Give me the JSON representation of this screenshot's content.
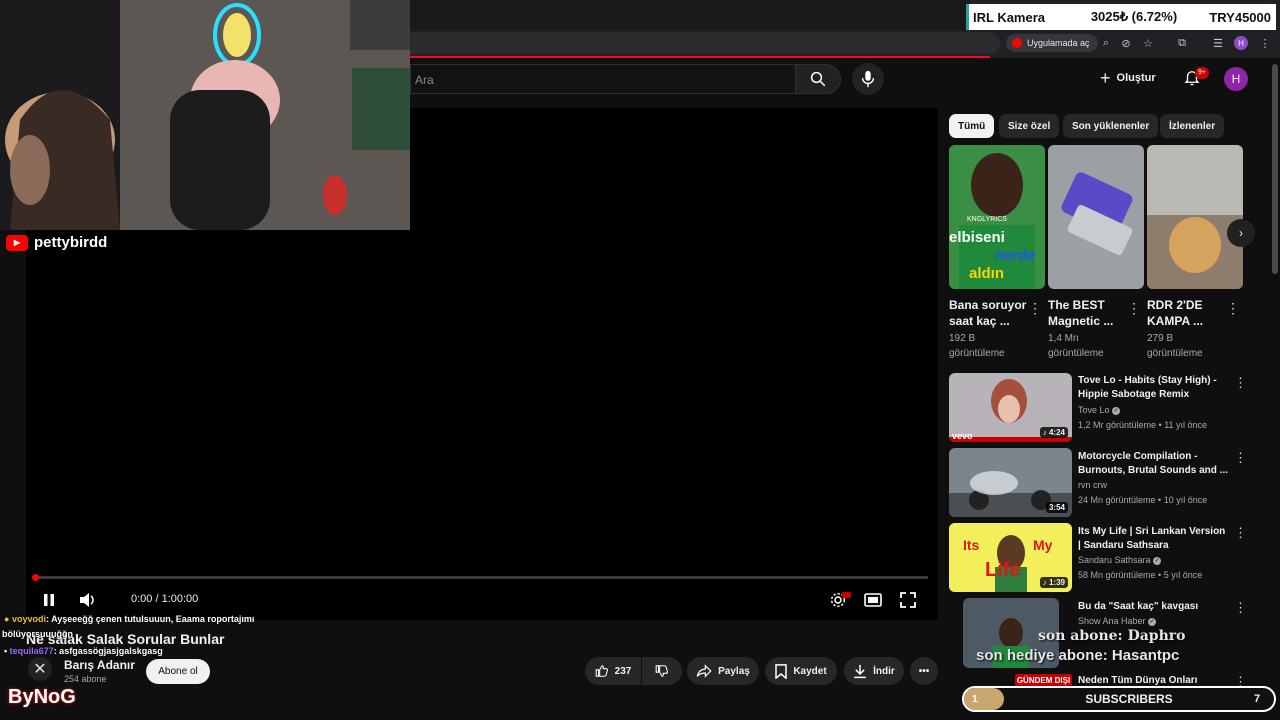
{
  "ticker": {
    "name": "IRL Kamera",
    "price": "3025₺ (6.72%)",
    "currency": "TRY45000"
  },
  "browser": {
    "open_in_app_label": "Uygulamada aç",
    "profile_initial": "H"
  },
  "masthead": {
    "search_placeholder": "Ara",
    "create_label": "Oluştur",
    "notification_count": "9+",
    "avatar_initial": "H"
  },
  "stream": {
    "streamer_name": "pettybirdd"
  },
  "player": {
    "time": "0:00 / 1:00:00",
    "progress": 0.0
  },
  "video": {
    "title": "Ne salak Salak Sorular Bunlar",
    "channel_name": "Barış Adanır",
    "channel_subs": "254 abone",
    "subscribe_label": "Abone ol",
    "like_count": "237",
    "share_label": "Paylaş",
    "save_label": "Kaydet",
    "download_label": "İndir"
  },
  "chat": [
    {
      "user": "voyvodi",
      "text": ": Ayşeeeğğ çenen tutulsuuun, Eaama roportajımı",
      "color": "#f0c020"
    },
    {
      "user": "",
      "text": "bölüyorsuuuğğn",
      "color": "#ffffff"
    },
    {
      "user": "tequila677",
      "text": ": asfgassögjasjgalskgasg",
      "color": "#9b6bff"
    }
  ],
  "overlay": {
    "logo": "ByNoG",
    "donation_line1": "son abone: Daphro",
    "donation_line2": "son hediye abone: Hasantpc"
  },
  "chips": [
    "Tümü",
    "Size özel",
    "Son yüklenenler",
    "İzlenenler"
  ],
  "shorts": [
    {
      "title": "Bana soruyor saat kaç ...",
      "views": "192 B",
      "views_label": "görüntüleme"
    },
    {
      "title": "The BEST Magnetic ...",
      "views": "1,4 Mn",
      "views_label": "görüntüleme"
    },
    {
      "title": "RDR 2'DE KAMPA ...",
      "views": "279 B",
      "views_label": "görüntüleme"
    }
  ],
  "shorts_thumb_text": {
    "short1_a": "elbiseni",
    "short1_b": "nerde",
    "short1_c": "aldın",
    "short1_tag": "KNGLYRICS"
  },
  "related": [
    {
      "title": "Tove Lo - Habits (Stay High) - Hippie Sabotage Remix",
      "channel": "Tove Lo",
      "verified": true,
      "meta": "1,2 Mr görüntüleme • 11 yıl önce",
      "duration": "4:24",
      "badge": "vevo"
    },
    {
      "title": "Motorcycle Compilation - Burnouts, Brutal Sounds and ...",
      "channel": "rvn crw",
      "verified": false,
      "meta": "24 Mn görüntüleme • 10 yıl önce",
      "duration": "3:54"
    },
    {
      "title": "Its My Life | Sri Lankan Version | Sandaru Sathsara",
      "channel": "Sandaru Sathsara",
      "verified": true,
      "meta": "58 Mn görüntüleme • 5 yıl önce",
      "duration": "1:39",
      "thumb_text_a": "Its",
      "thumb_text_b": "My",
      "thumb_text_c": "Life"
    },
    {
      "title": "Bu da \"Saat kaç\" kavgası",
      "channel": "Show Ana Haber",
      "verified": true
    },
    {
      "title": "Neden Tüm Dünya Onları",
      "thumb_tag": "GÜNDEM DIŞI"
    }
  ],
  "subs_bar": {
    "current": "1",
    "label": "SUBSCRIBERS",
    "goal": "7"
  },
  "colors": {
    "accent": "#ff0000",
    "background": "#0f0f0f",
    "chip_active": "#f1f1f1"
  }
}
